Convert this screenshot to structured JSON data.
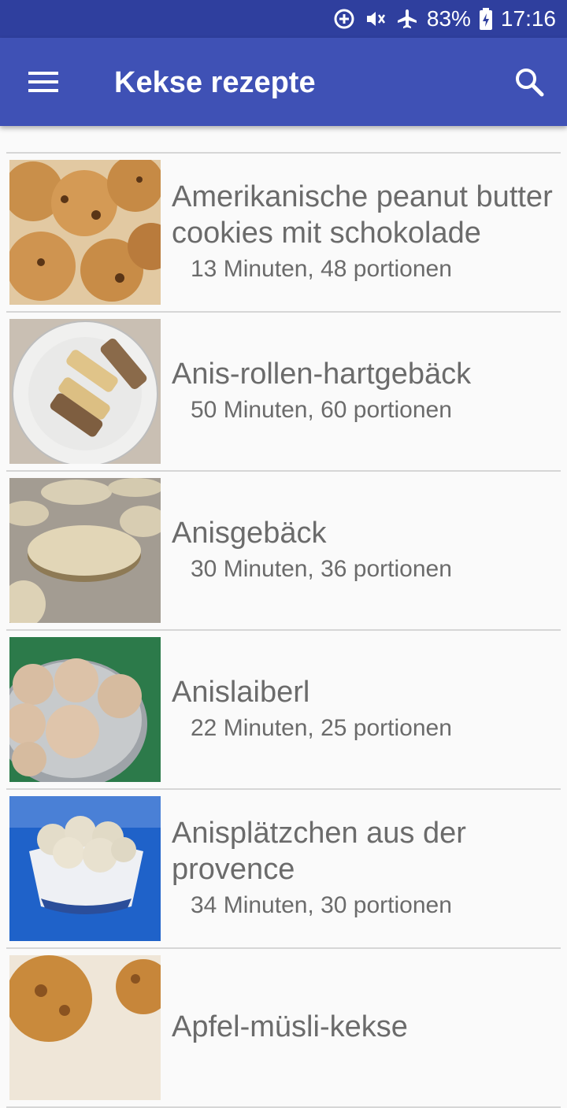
{
  "status_bar": {
    "battery_text": "83%",
    "time": "17:16",
    "icons": [
      "data-saver-icon",
      "vibrate-mute-icon",
      "airplane-icon",
      "battery-charging-icon"
    ]
  },
  "app_bar": {
    "title": "Kekse rezepte",
    "menu_icon": "hamburger-menu-icon",
    "search_icon": "search-icon",
    "color": "#3f51b5",
    "status_color": "#2f3f9e"
  },
  "recipes": [
    {
      "title": "Amerikanische peanut butter cookies mit schokolade",
      "meta": "13 Minuten, 48 portionen"
    },
    {
      "title": "Anis-rollen-hartgebäck",
      "meta": "50 Minuten, 60 portionen"
    },
    {
      "title": "Anisgebäck",
      "meta": "30 Minuten, 36 portionen"
    },
    {
      "title": "Anislaiberl",
      "meta": "22 Minuten, 25 portionen"
    },
    {
      "title": "Anisplätzchen aus der provence",
      "meta": "34 Minuten, 30 portionen"
    },
    {
      "title": "Apfel-müsli-kekse",
      "meta": ""
    }
  ]
}
